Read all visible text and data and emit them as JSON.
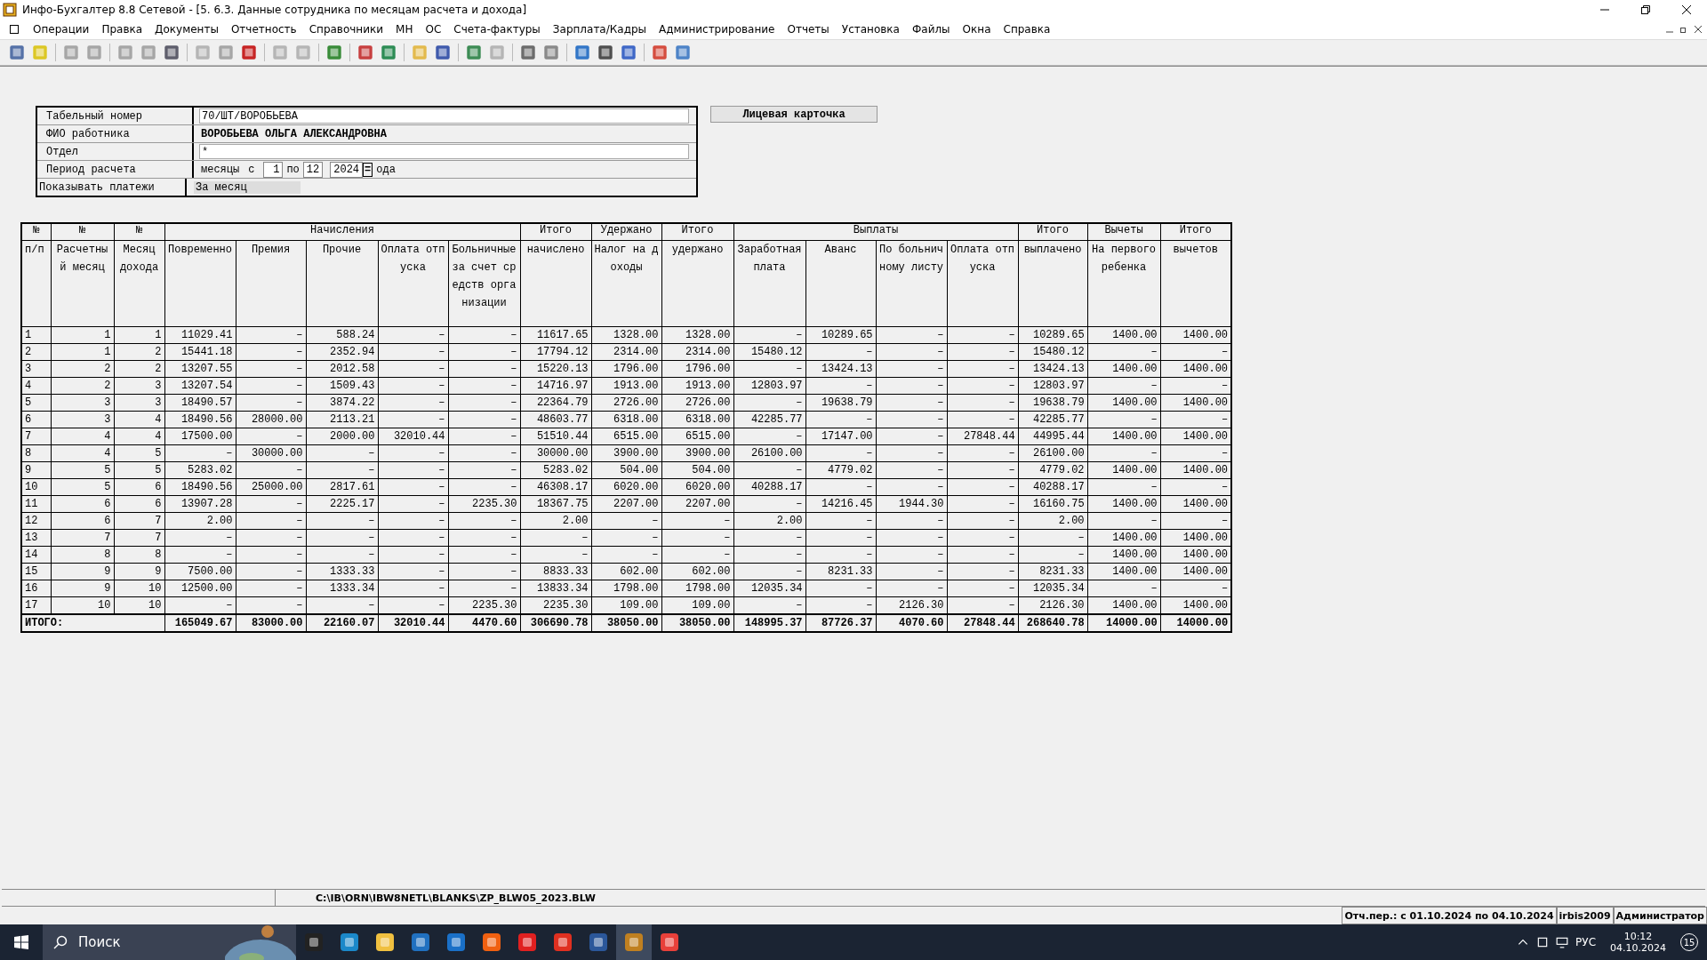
{
  "window": {
    "title": "Инфо-Бухгалтер 8.8 Сетевой - [5.  6.3. Данные сотрудника по месяцам расчета и дохода]"
  },
  "menu": [
    "Операции",
    "Правка",
    "Документы",
    "Отчетность",
    "Справочники",
    "МН",
    "ОС",
    "Счета-фактуры",
    "Зарплата/Кадры",
    "Администрирование",
    "Отчеты",
    "Установка",
    "Файлы",
    "Окна",
    "Справка"
  ],
  "form": {
    "fields": [
      {
        "label": "Табельный номер",
        "value": "70/ШТ/ВОРОБЬЕВА",
        "kind": "input"
      },
      {
        "label": "ФИО работника",
        "value": "ВОРОБЬЕВА ОЛЬГА АЛЕКСАНДРОВНА",
        "kind": "bold"
      },
      {
        "label": "Отдел",
        "value": "*",
        "kind": "input"
      }
    ],
    "period": {
      "label": "Период расчета",
      "unit": "месяцы",
      "from_label": "с",
      "from": "1",
      "to_label": "по",
      "to": "12",
      "year": "2024",
      "eq": "=",
      "suffix": "ода"
    },
    "payments": {
      "label": "Показывать платежи",
      "value": "За месяц"
    },
    "card_button": "Лицевая карточка"
  },
  "table": {
    "header_top": [
      "№",
      "№",
      "№",
      "Начисления",
      "Итого",
      "Удержано",
      "Итого",
      "Выплаты",
      "Итого",
      "Вычеты",
      "Итого"
    ],
    "header_sub": [
      "п/п",
      "Расчетный месяц",
      "Месяц дохода",
      "Повременно",
      "Премия",
      "Прочие",
      "Оплата отпуска",
      "Больничные за счет средств организации",
      "начислено",
      "Налог на доходы",
      "удержано",
      "Заработная плата",
      "Аванс",
      "По больничному листу",
      "Оплата отпуска",
      "выплачено",
      "На первого ребенка",
      "вычетов"
    ],
    "rows": [
      [
        "1",
        "1",
        "1",
        "11029.41",
        "–",
        "588.24",
        "–",
        "–",
        "11617.65",
        "1328.00",
        "1328.00",
        "–",
        "10289.65",
        "–",
        "–",
        "10289.65",
        "1400.00",
        "1400.00"
      ],
      [
        "2",
        "1",
        "2",
        "15441.18",
        "–",
        "2352.94",
        "–",
        "–",
        "17794.12",
        "2314.00",
        "2314.00",
        "15480.12",
        "–",
        "–",
        "–",
        "15480.12",
        "–",
        "–"
      ],
      [
        "3",
        "2",
        "2",
        "13207.55",
        "–",
        "2012.58",
        "–",
        "–",
        "15220.13",
        "1796.00",
        "1796.00",
        "–",
        "13424.13",
        "–",
        "–",
        "13424.13",
        "1400.00",
        "1400.00"
      ],
      [
        "4",
        "2",
        "3",
        "13207.54",
        "–",
        "1509.43",
        "–",
        "–",
        "14716.97",
        "1913.00",
        "1913.00",
        "12803.97",
        "–",
        "–",
        "–",
        "12803.97",
        "–",
        "–"
      ],
      [
        "5",
        "3",
        "3",
        "18490.57",
        "–",
        "3874.22",
        "–",
        "–",
        "22364.79",
        "2726.00",
        "2726.00",
        "–",
        "19638.79",
        "–",
        "–",
        "19638.79",
        "1400.00",
        "1400.00"
      ],
      [
        "6",
        "3",
        "4",
        "18490.56",
        "28000.00",
        "2113.21",
        "–",
        "–",
        "48603.77",
        "6318.00",
        "6318.00",
        "42285.77",
        "–",
        "–",
        "–",
        "42285.77",
        "–",
        "–"
      ],
      [
        "7",
        "4",
        "4",
        "17500.00",
        "–",
        "2000.00",
        "32010.44",
        "–",
        "51510.44",
        "6515.00",
        "6515.00",
        "–",
        "17147.00",
        "–",
        "27848.44",
        "44995.44",
        "1400.00",
        "1400.00"
      ],
      [
        "8",
        "4",
        "5",
        "–",
        "30000.00",
        "–",
        "–",
        "–",
        "30000.00",
        "3900.00",
        "3900.00",
        "26100.00",
        "–",
        "–",
        "–",
        "26100.00",
        "–",
        "–"
      ],
      [
        "9",
        "5",
        "5",
        "5283.02",
        "–",
        "–",
        "–",
        "–",
        "5283.02",
        "504.00",
        "504.00",
        "–",
        "4779.02",
        "–",
        "–",
        "4779.02",
        "1400.00",
        "1400.00"
      ],
      [
        "10",
        "5",
        "6",
        "18490.56",
        "25000.00",
        "2817.61",
        "–",
        "–",
        "46308.17",
        "6020.00",
        "6020.00",
        "40288.17",
        "–",
        "–",
        "–",
        "40288.17",
        "–",
        "–"
      ],
      [
        "11",
        "6",
        "6",
        "13907.28",
        "–",
        "2225.17",
        "–",
        "2235.30",
        "18367.75",
        "2207.00",
        "2207.00",
        "–",
        "14216.45",
        "1944.30",
        "–",
        "16160.75",
        "1400.00",
        "1400.00"
      ],
      [
        "12",
        "6",
        "7",
        "2.00",
        "–",
        "–",
        "–",
        "–",
        "2.00",
        "–",
        "–",
        "2.00",
        "–",
        "–",
        "–",
        "2.00",
        "–",
        "–"
      ],
      [
        "13",
        "7",
        "7",
        "–",
        "–",
        "–",
        "–",
        "–",
        "–",
        "–",
        "–",
        "–",
        "–",
        "–",
        "–",
        "–",
        "1400.00",
        "1400.00"
      ],
      [
        "14",
        "8",
        "8",
        "–",
        "–",
        "–",
        "–",
        "–",
        "–",
        "–",
        "–",
        "–",
        "–",
        "–",
        "–",
        "–",
        "1400.00",
        "1400.00"
      ],
      [
        "15",
        "9",
        "9",
        "7500.00",
        "–",
        "1333.33",
        "–",
        "–",
        "8833.33",
        "602.00",
        "602.00",
        "–",
        "8231.33",
        "–",
        "–",
        "8231.33",
        "1400.00",
        "1400.00"
      ],
      [
        "16",
        "9",
        "10",
        "12500.00",
        "–",
        "1333.34",
        "–",
        "–",
        "13833.34",
        "1798.00",
        "1798.00",
        "12035.34",
        "–",
        "–",
        "–",
        "12035.34",
        "–",
        "–"
      ],
      [
        "17",
        "10",
        "10",
        "–",
        "–",
        "–",
        "–",
        "2235.30",
        "2235.30",
        "109.00",
        "109.00",
        "–",
        "–",
        "2126.30",
        "–",
        "2126.30",
        "1400.00",
        "1400.00"
      ]
    ],
    "total_label": "ИТОГО:",
    "totals": [
      "165049.67",
      "83000.00",
      "22160.07",
      "32010.44",
      "4470.60",
      "306690.78",
      "38050.00",
      "38050.00",
      "148995.37",
      "87726.37",
      "4070.60",
      "27848.44",
      "268640.78",
      "14000.00",
      "14000.00"
    ]
  },
  "status_bar": {
    "path": "C:\\IB\\ORN\\IBW8NETL\\BLANKS\\ZP_BLW05_2023.BLW",
    "period": "Отч.пер.: с 01.10.2024 по 04.10.2024",
    "user_db": "irbis2009",
    "role": "Администратор"
  },
  "taskbar": {
    "search": "Поиск",
    "lang": "РУС",
    "time": "10:12",
    "date": "04.10.2024",
    "notifications": "15"
  }
}
